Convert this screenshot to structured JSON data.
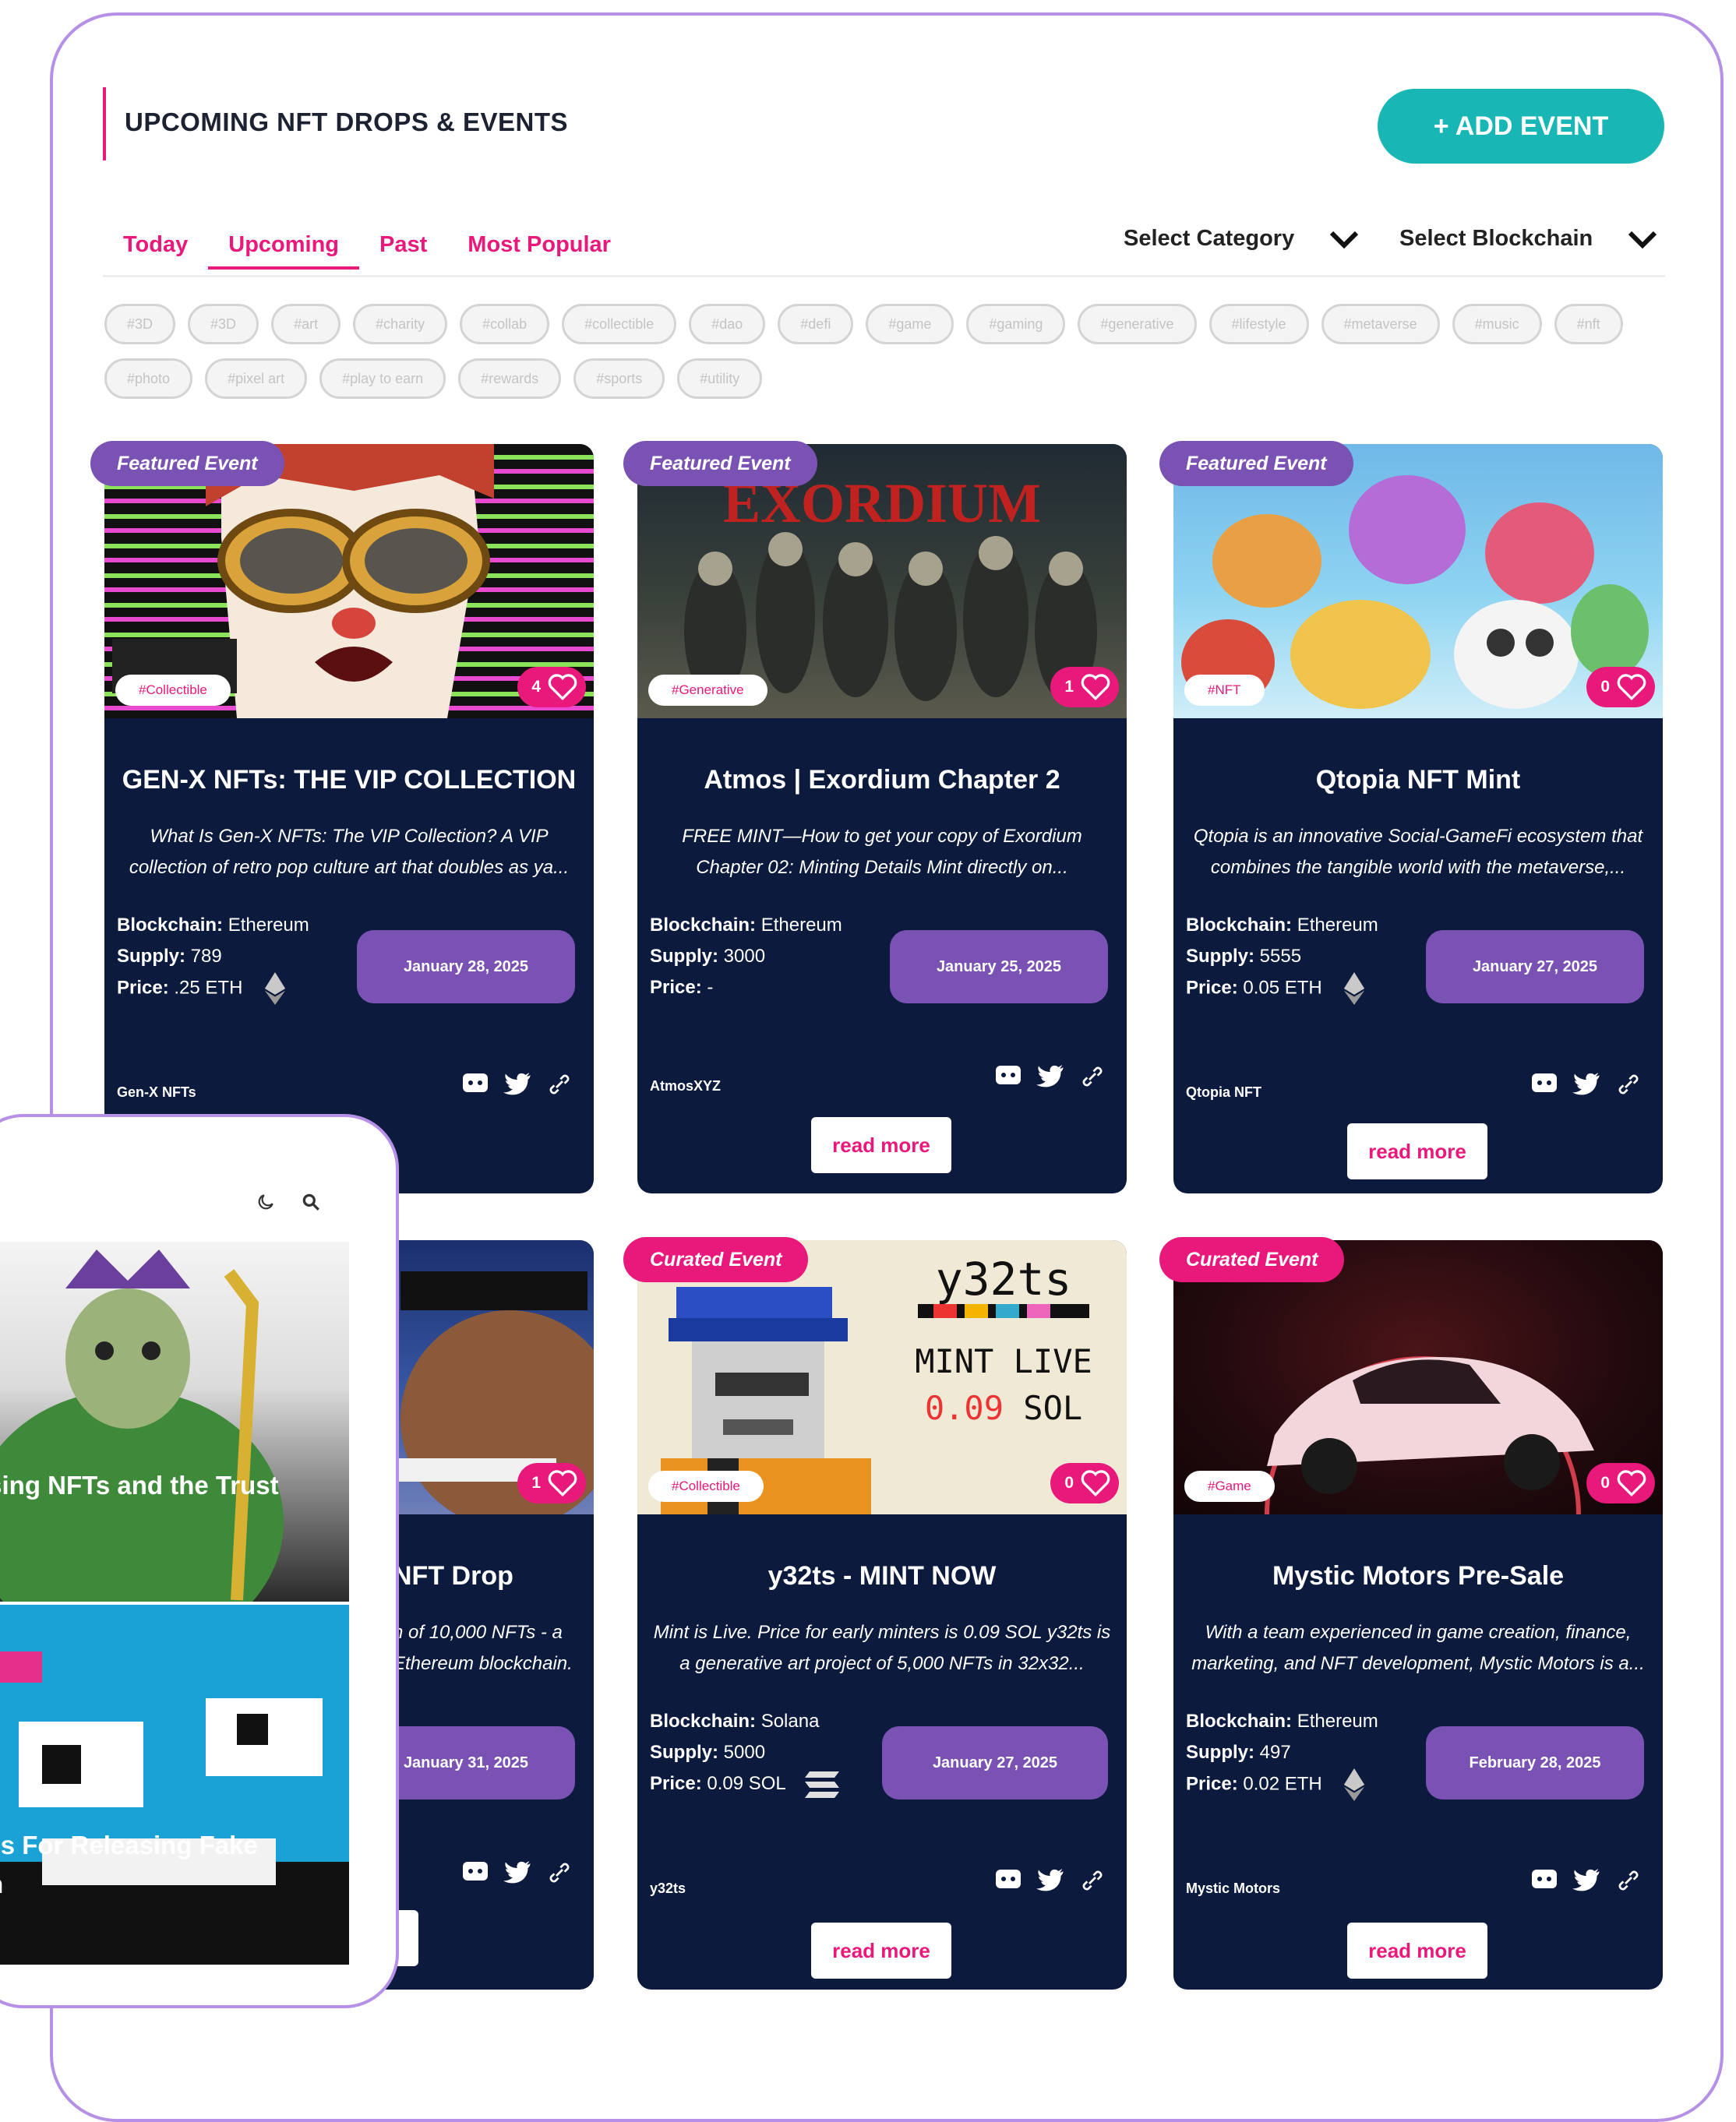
{
  "header": {
    "title": "UPCOMING NFT DROPS & EVENTS",
    "add_event_label": "+ ADD EVENT"
  },
  "tabs": [
    {
      "label": "Today"
    },
    {
      "label": "Upcoming",
      "active": true
    },
    {
      "label": "Past"
    },
    {
      "label": "Most Popular"
    }
  ],
  "filters": {
    "category_label": "Select Category",
    "blockchain_label": "Select Blockchain"
  },
  "tags": {
    "row1": [
      "#3D",
      "#3D",
      "#art",
      "#charity",
      "#collab",
      "#collectible",
      "#dao",
      "#defi",
      "#game",
      "#gaming",
      "#generative",
      "#lifestyle",
      "#metaverse",
      "#music"
    ],
    "row2": [
      "#nft",
      "#photo",
      "#pixel art",
      "#play to earn",
      "#rewards",
      "#sports",
      "#utility"
    ]
  },
  "cards": [
    {
      "badge": "Featured Event",
      "category": "#Collectible",
      "likes": "4",
      "title": "GEN-X NFTs: THE VIP COLLECTION",
      "description": "What Is Gen-X NFTs: The VIP Collection? A VIP collection of retro pop culture art that doubles as ya...",
      "blockchain": "Ethereum",
      "supply": "789",
      "price": ".25 ETH",
      "date": "January 28, 2025",
      "project": "Gen-X NFTs",
      "read_more": "read more"
    },
    {
      "badge": "Featured Event",
      "category": "#Generative",
      "likes": "1",
      "title": "Atmos | Exordium Chapter 2",
      "description": "FREE MINT—How to get your copy of Exordium Chapter 02: Minting Details Mint directly on...",
      "blockchain": "Ethereum",
      "supply": "3000",
      "price": "-",
      "date": "January 25, 2025",
      "project": "AtmosXYZ",
      "read_more": "read more",
      "banner_text": "EXORDIUM"
    },
    {
      "badge": "Featured Event",
      "category": "#NFT",
      "likes": "0",
      "title": "Qtopia NFT Mint",
      "description": "Qtopia is an innovative Social-GameFi ecosystem that combines the tangible world with the metaverse,...",
      "blockchain": "Ethereum",
      "supply": "5555",
      "price": "0.05 ETH",
      "date": "January 27, 2025",
      "project": "Qtopia NFT",
      "read_more": "read more"
    },
    {
      "badge": "",
      "category": "",
      "likes": "1",
      "title": "NFT Drop",
      "description": "n of 10,000 NFTs - a Ethereum blockchain.",
      "blockchain": "",
      "supply": "",
      "price": "",
      "date": "January 31, 2025",
      "project": "",
      "read_more": "e"
    },
    {
      "badge": "Curated Event",
      "category": "#Collectible",
      "likes": "0",
      "title": "y32ts - MINT NOW",
      "description": "Mint is Live. Price for early minters is 0.09 SOL y32ts is a generative art project of 5,000 NFTs in 32x32...",
      "blockchain": "Solana",
      "supply": "5000",
      "price": "0.09 SOL",
      "date": "January 27, 2025",
      "project": "y32ts",
      "read_more": "read more",
      "art": {
        "logo": "y32ts",
        "line1": "MINT LIVE",
        "line2_red": "0.09",
        "line2_rest": "SOL"
      }
    },
    {
      "badge": "Curated Event",
      "category": "#Game",
      "likes": "0",
      "title": "Mystic Motors Pre-Sale",
      "description": "With a team experienced in game creation, finance, marketing, and NFT development, Mystic Motors is a...",
      "blockchain": "Ethereum",
      "supply": "497",
      "price": "0.02 ETH",
      "date": "February 28, 2025",
      "project": "Mystic Motors",
      "read_more": "read more"
    }
  ],
  "labels": {
    "blockchain": "Blockchain:",
    "supply": "Supply:",
    "price": "Price:"
  },
  "phone": {
    "story1": "osing NFTs and the Trust",
    "story2_line1": "ses For Releasing Fake",
    "story2_line2": "on"
  },
  "colors": {
    "accent_pink": "#e8197a",
    "accent_teal": "#18b7b5",
    "purple": "#7952b3",
    "card_navy": "#0c1a3d",
    "frame_border": "#b690e6"
  }
}
